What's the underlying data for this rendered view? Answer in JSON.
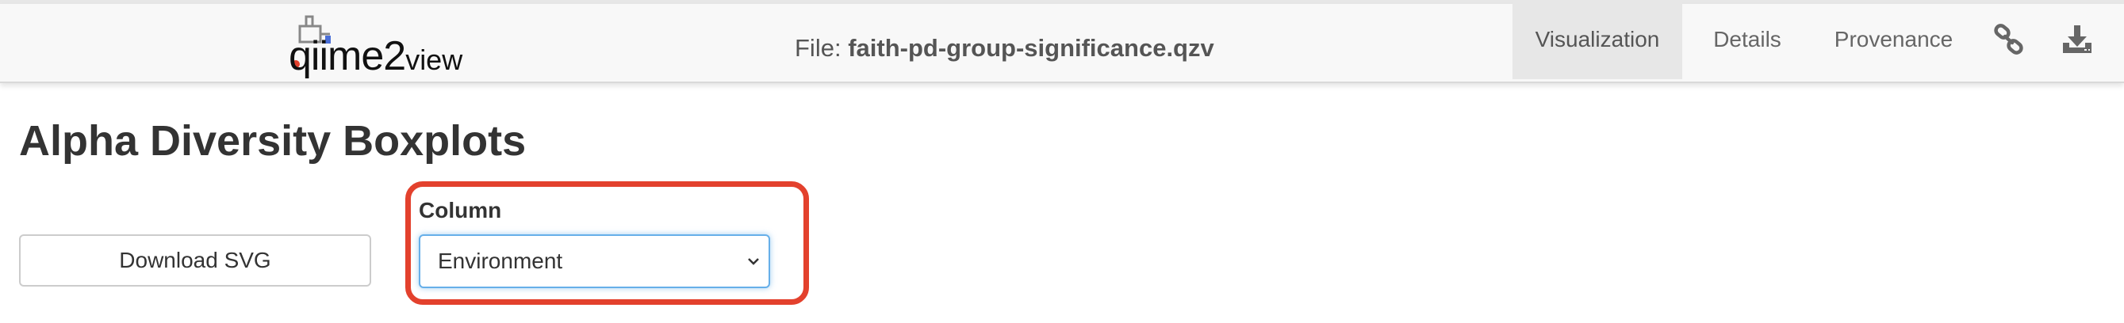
{
  "header": {
    "logo_text": "qiime2",
    "logo_view": "view",
    "file_prefix": "File: ",
    "file_name": "faith-pd-group-significance.qzv",
    "nav": {
      "visualization": "Visualization",
      "details": "Details",
      "provenance": "Provenance"
    },
    "icons": {
      "link": "link-icon",
      "download": "download-icon"
    }
  },
  "main": {
    "title": "Alpha Diversity Boxplots",
    "download_label": "Download SVG",
    "column_label": "Column",
    "column_selected": "Environment"
  },
  "colors": {
    "highlight": "#e3412d",
    "nav_background": "#f8f8f8",
    "active_tab": "#e7e7e7",
    "select_focus": "#66afe9"
  }
}
